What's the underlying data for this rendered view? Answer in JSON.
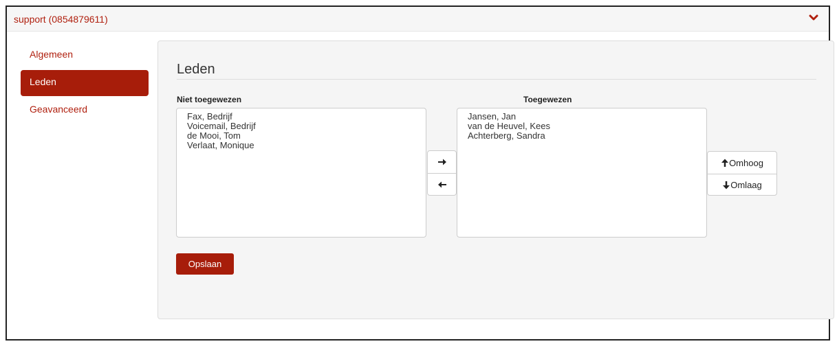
{
  "panel": {
    "title": "support (0854879611)"
  },
  "nav": {
    "items": [
      {
        "label": "Algemeen"
      },
      {
        "label": "Leden"
      },
      {
        "label": "Geavanceerd"
      }
    ],
    "active": "Leden"
  },
  "section": {
    "title": "Leden"
  },
  "unassigned": {
    "label": "Niet toegewezen",
    "options": [
      "Fax, Bedrijf",
      "Voicemail, Bedrijf",
      "de Mooi, Tom",
      "Verlaat, Monique"
    ]
  },
  "assigned": {
    "label": "Toegewezen",
    "options": [
      "Jansen, Jan",
      "van de Heuvel, Kees",
      "Achterberg, Sandra"
    ]
  },
  "order_buttons": {
    "up_label": "Omhoog",
    "down_label": "Omlaag"
  },
  "actions": {
    "save_label": "Opslaan"
  },
  "colors": {
    "accent": "#a71d0a",
    "link": "#b0200f"
  }
}
